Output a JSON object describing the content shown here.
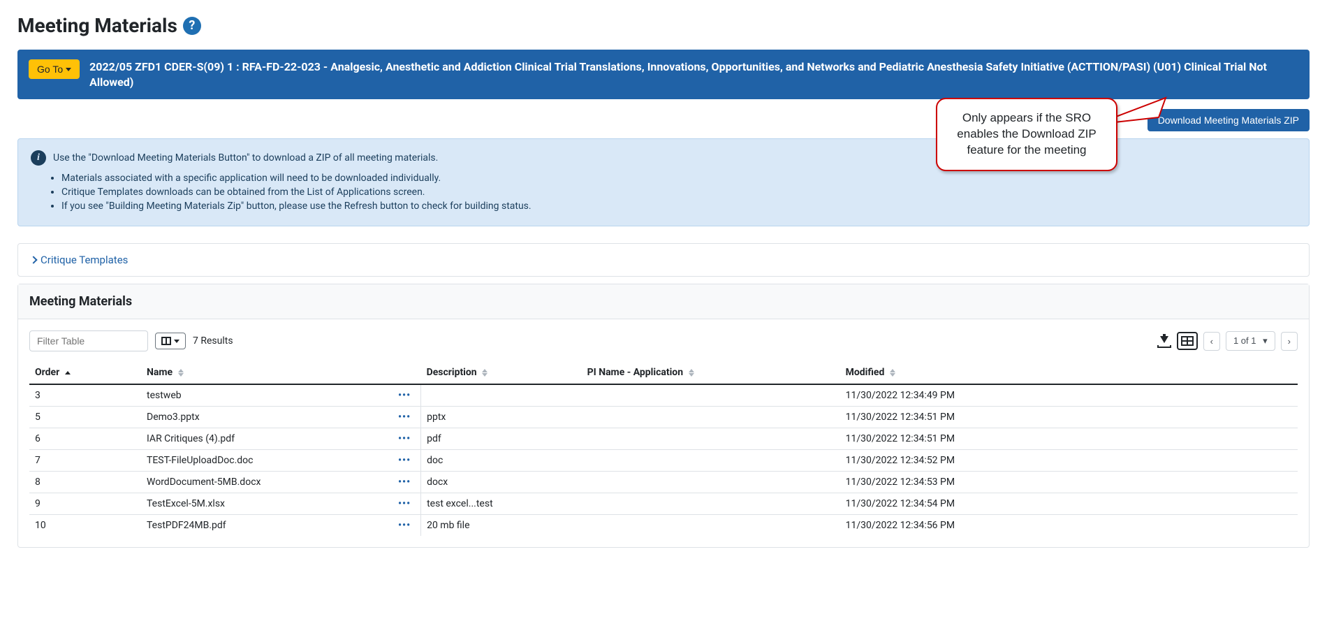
{
  "page_title": "Meeting Materials",
  "goto_label": "Go To",
  "meeting_title": "2022/05 ZFD1 CDER-S(09) 1 : RFA-FD-22-023 - Analgesic, Anesthetic and Addiction Clinical Trial Translations, Innovations, Opportunities, and Networks and Pediatric Anesthesia Safety Initiative (ACTTION/PASI) (U01) Clinical Trial Not Allowed)",
  "download_zip_label": "Download Meeting Materials ZIP",
  "callout_text": "Only appears if the SRO enables the Download ZIP feature for the meeting",
  "info": {
    "lead": "Use the \"Download Meeting Materials Button\" to download a ZIP of all meeting materials.",
    "items": [
      "Materials associated with a specific application will need to be downloaded individually.",
      "Critique Templates downloads can be obtained from the List of Applications screen.",
      "If you see \"Building Meeting Materials Zip\" button, please use the Refresh button to check for building status."
    ]
  },
  "critique_templates_label": "Critique Templates",
  "panel_header": "Meeting Materials",
  "filter_placeholder": "Filter Table",
  "results_text": "7 Results",
  "pager_text": "1 of 1",
  "columns": {
    "order": "Order",
    "name": "Name",
    "description": "Description",
    "pi": "PI Name - Application",
    "modified": "Modified"
  },
  "rows": [
    {
      "order": "3",
      "name": "testweb",
      "desc": "",
      "pi": "",
      "modified": "11/30/2022 12:34:49 PM"
    },
    {
      "order": "5",
      "name": "Demo3.pptx",
      "desc": "pptx",
      "pi": "",
      "modified": "11/30/2022 12:34:51 PM"
    },
    {
      "order": "6",
      "name": "IAR Critiques (4).pdf",
      "desc": "pdf",
      "pi": "",
      "modified": "11/30/2022 12:34:51 PM"
    },
    {
      "order": "7",
      "name": "TEST-FileUploadDoc.doc",
      "desc": "doc",
      "pi": "",
      "modified": "11/30/2022 12:34:52 PM"
    },
    {
      "order": "8",
      "name": "WordDocument-5MB.docx",
      "desc": "docx",
      "pi": "",
      "modified": "11/30/2022 12:34:53 PM"
    },
    {
      "order": "9",
      "name": "TestExcel-5M.xlsx",
      "desc": "test excel...test",
      "pi": "",
      "modified": "11/30/2022 12:34:54 PM"
    },
    {
      "order": "10",
      "name": "TestPDF24MB.pdf",
      "desc": "20 mb file",
      "pi": "",
      "modified": "11/30/2022 12:34:56 PM"
    }
  ]
}
